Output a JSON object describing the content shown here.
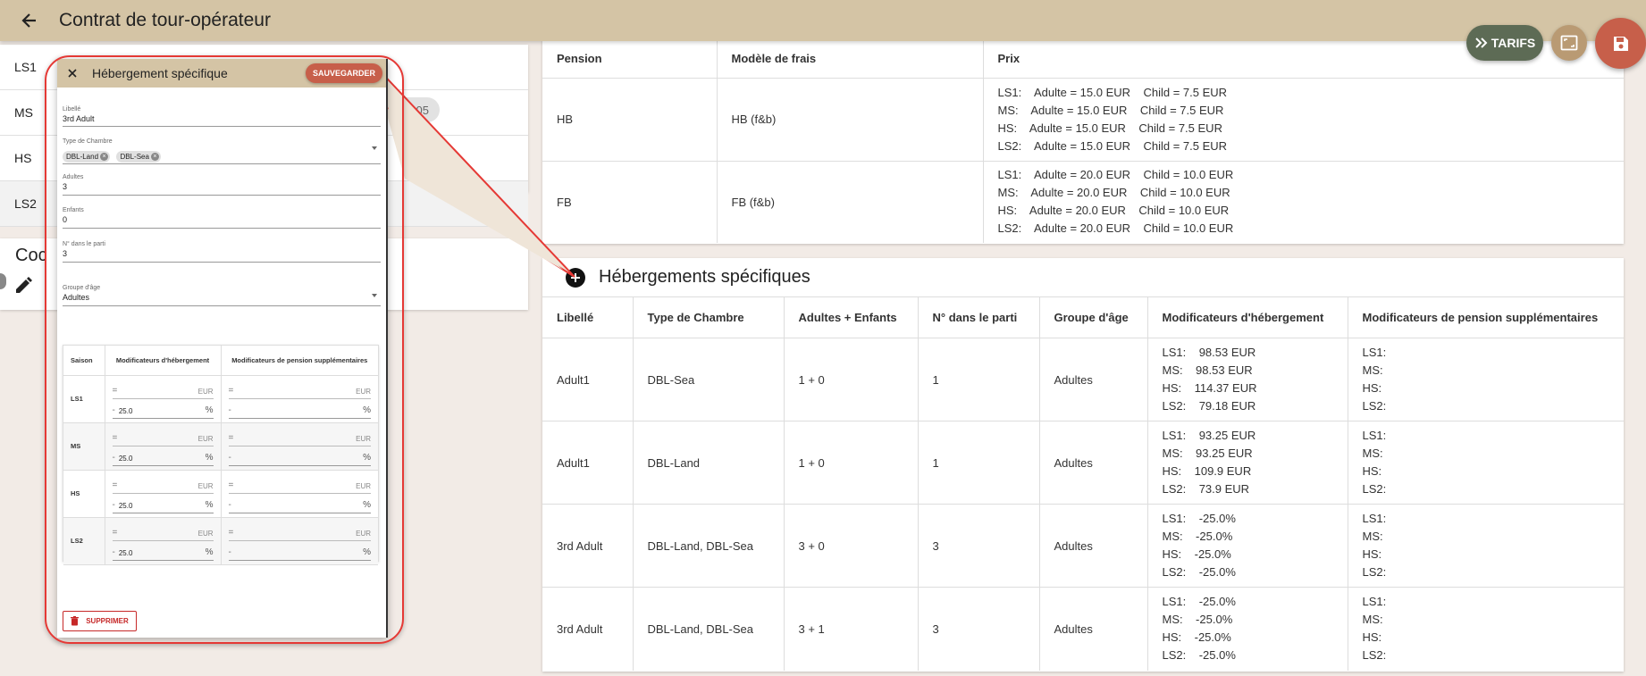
{
  "header": {
    "title": "Contrat de tour-opérateur"
  },
  "fabs": {
    "tarifs_label": "TARIFS"
  },
  "left_panel": {
    "seasons": [
      "LS1",
      "MS",
      "HS",
      "LS2"
    ],
    "chip_text": "05",
    "card2_title": "Coc"
  },
  "pension_table": {
    "headers": [
      "Pension",
      "Modèle de frais",
      "Prix"
    ],
    "rows": [
      {
        "pension": "HB",
        "model": "HB (f&b)",
        "prix": [
          "LS1:    Adulte = 15.0 EUR    Child = 7.5 EUR",
          "MS:    Adulte = 15.0 EUR    Child = 7.5 EUR",
          "HS:    Adulte = 15.0 EUR    Child = 7.5 EUR",
          "LS2:    Adulte = 15.0 EUR    Child = 7.5 EUR"
        ]
      },
      {
        "pension": "FB",
        "model": "FB (f&b)",
        "prix": [
          "LS1:    Adulte = 20.0 EUR    Child = 10.0 EUR",
          "MS:    Adulte = 20.0 EUR    Child = 10.0 EUR",
          "HS:    Adulte = 20.0 EUR    Child = 10.0 EUR",
          "LS2:    Adulte = 20.0 EUR    Child = 10.0 EUR"
        ]
      }
    ]
  },
  "specific": {
    "title": "Hébergements spécifiques",
    "headers": [
      "Libellé",
      "Type de Chambre",
      "Adultes + Enfants",
      "N° dans le parti",
      "Groupe d'âge",
      "Modificateurs d'hébergement",
      "Modificateurs de pension supplémentaires"
    ],
    "rows": [
      {
        "libelle": "Adult1",
        "type": "DBL-Sea",
        "ae": "1 + 0",
        "num": "1",
        "groupe": "Adultes",
        "mods": [
          "LS1:    98.53 EUR",
          "MS:    98.53 EUR",
          "HS:    114.37 EUR",
          "LS2:    79.18 EUR"
        ],
        "pension_mods": [
          "LS1:",
          "MS:",
          "HS:",
          "LS2:"
        ]
      },
      {
        "libelle": "Adult1",
        "type": "DBL-Land",
        "ae": "1 + 0",
        "num": "1",
        "groupe": "Adultes",
        "mods": [
          "LS1:    93.25 EUR",
          "MS:    93.25 EUR",
          "HS:    109.9 EUR",
          "LS2:    73.9 EUR"
        ],
        "pension_mods": [
          "LS1:",
          "MS:",
          "HS:",
          "LS2:"
        ]
      },
      {
        "libelle": "3rd Adult",
        "type": "DBL-Land, DBL-Sea",
        "ae": "3 + 0",
        "num": "3",
        "groupe": "Adultes",
        "mods": [
          "LS1:    -25.0%",
          "MS:    -25.0%",
          "HS:    -25.0%",
          "LS2:    -25.0%"
        ],
        "pension_mods": [
          "LS1:",
          "MS:",
          "HS:",
          "LS2:"
        ]
      },
      {
        "libelle": "3rd Adult",
        "type": "DBL-Land, DBL-Sea",
        "ae": "3 + 1",
        "num": "3",
        "groupe": "Adultes",
        "mods": [
          "LS1:    -25.0%",
          "MS:    -25.0%",
          "HS:    -25.0%",
          "LS2:    -25.0%"
        ],
        "pension_mods": [
          "LS1:",
          "MS:",
          "HS:",
          "LS2:"
        ]
      }
    ]
  },
  "dialog": {
    "title": "Hébergement spécifique",
    "save_label": "SAUVEGARDER",
    "libelle_label": "Libellé",
    "libelle_value": "3rd Adult",
    "type_label": "Type de Chambre",
    "type_chips": [
      "DBL-Land",
      "DBL-Sea"
    ],
    "adultes_label": "Adultes",
    "adultes_value": "3",
    "enfants_label": "Enfants",
    "enfants_value": "0",
    "num_label": "N° dans le parti",
    "num_value": "3",
    "groupe_label": "Groupe d'âge",
    "groupe_value": "Adultes",
    "mod_headers": [
      "Saison",
      "Modificateurs d'hébergement",
      "Modificateurs de pension supplémentaires"
    ],
    "mod_rows": [
      {
        "season": "LS1",
        "sym1": "=",
        "unit1": "EUR",
        "sym2": "-",
        "val2": "25.0",
        "unit2": "%",
        "psym1": "=",
        "punit1": "EUR",
        "psym2": "-",
        "punit2": "%"
      },
      {
        "season": "MS",
        "sym1": "=",
        "unit1": "EUR",
        "sym2": "-",
        "val2": "25.0",
        "unit2": "%",
        "psym1": "=",
        "punit1": "EUR",
        "psym2": "-",
        "punit2": "%"
      },
      {
        "season": "HS",
        "sym1": "=",
        "unit1": "EUR",
        "sym2": "-",
        "val2": "25.0",
        "unit2": "%",
        "psym1": "=",
        "punit1": "EUR",
        "psym2": "-",
        "punit2": "%"
      },
      {
        "season": "LS2",
        "sym1": "=",
        "unit1": "EUR",
        "sym2": "-",
        "val2": "25.0",
        "unit2": "%",
        "psym1": "=",
        "punit1": "EUR",
        "psym2": "-",
        "punit2": "%"
      }
    ],
    "delete_label": "SUPPRIMER"
  },
  "colors": {
    "topbar": "#d4c4a5",
    "tarifs": "#5d6b55",
    "save": "#c75f4a",
    "callout": "#e53935"
  }
}
